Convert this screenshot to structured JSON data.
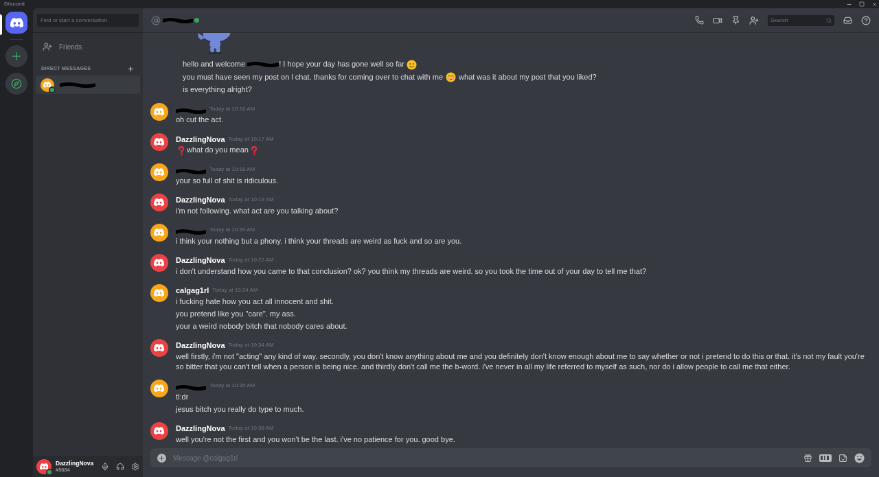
{
  "window": {
    "title": "Discord"
  },
  "search": {
    "placeholder": "Find or start a conversation"
  },
  "nav": [
    {
      "label": "Friends",
      "selected": false
    }
  ],
  "dm_section": {
    "title": "DIRECT MESSAGES"
  },
  "direct_messages": [
    {
      "selected": true,
      "online": true,
      "color": "#faa61a"
    }
  ],
  "header": {
    "online": true
  },
  "header_search": {
    "placeholder": "Search"
  },
  "messages": [
    {
      "kind": "continuation",
      "lines": [
        [
          {
            "kind": "text",
            "text": "hello and welcome "
          },
          {
            "kind": "redaction"
          },
          {
            "kind": "text",
            "text": "! I hope your day has gone well so far"
          },
          {
            "kind": "smile"
          }
        ],
        [
          {
            "kind": "text",
            "text": "you must have seen my post on l chat. thanks for coming over to chat with me"
          },
          {
            "kind": "blush"
          },
          {
            "kind": "text",
            "text": "what was it about my post that you liked?"
          }
        ],
        [
          {
            "kind": "text",
            "text": "is everything alright?"
          }
        ]
      ]
    },
    {
      "kind": "group",
      "redacted": true,
      "color": "#faa61a",
      "time": "Today at 10:16 AM",
      "lines": [
        [
          {
            "kind": "text",
            "text": "oh cut the act."
          }
        ]
      ]
    },
    {
      "kind": "group",
      "redacted": false,
      "author": "DazzlingNova",
      "color": "#ed4245",
      "time": "Today at 10:17 AM",
      "lines": [
        [
          {
            "kind": "question"
          },
          {
            "kind": "text",
            "text": "what do you mean"
          },
          {
            "kind": "question"
          }
        ]
      ]
    },
    {
      "kind": "group",
      "redacted": true,
      "color": "#faa61a",
      "time": "Today at 10:18 AM",
      "lines": [
        [
          {
            "kind": "text",
            "text": "your so full of shit is ridiculous."
          }
        ]
      ]
    },
    {
      "kind": "group",
      "redacted": false,
      "author": "DazzlingNova",
      "color": "#ed4245",
      "time": "Today at 10:19 AM",
      "lines": [
        [
          {
            "kind": "text",
            "text": "i'm not following. what act are you talking about?"
          }
        ]
      ]
    },
    {
      "kind": "group",
      "redacted": true,
      "color": "#faa61a",
      "time": "Today at 10:20 AM",
      "lines": [
        [
          {
            "kind": "text",
            "text": "i think your nothing but a phony. i think your threads are weird as fuck and so are you."
          }
        ]
      ]
    },
    {
      "kind": "group",
      "redacted": false,
      "author": "DazzlingNova",
      "color": "#ed4245",
      "time": "Today at 10:22 AM",
      "lines": [
        [
          {
            "kind": "text",
            "text": "i don't understand how you came to that conclusion? ok? you think my threads are weird. so you took the time out of your day to tell me that?"
          }
        ]
      ]
    },
    {
      "kind": "group",
      "redacted": false,
      "author": "calgag1rl",
      "color": "#faa61a",
      "time": "Today at 10:24 AM",
      "lines": [
        [
          {
            "kind": "text",
            "text": "i fucking hate how you act all innocent and shit."
          }
        ],
        [
          {
            "kind": "text",
            "text": "you pretend like you \"care\". my ass."
          }
        ],
        [
          {
            "kind": "text",
            "text": "your a weird nobody bitch that nobody cares about."
          }
        ]
      ]
    },
    {
      "kind": "group",
      "redacted": false,
      "author": "DazzlingNova",
      "color": "#ed4245",
      "time": "Today at 10:34 AM",
      "lines": [
        [
          {
            "kind": "text",
            "text": "well firstly, i'm not \"acting\" any kind of way. secondly, you don't know anything about me and you definitely don't know enough about me to say whether or not i pretend to do this or that. it's not my fault you're so bitter that you can't tell when a person is being nice. and thirdly don't call me the b-word. i've never in all my life referred to myself as such, nor do i allow people to call me that either."
          }
        ]
      ]
    },
    {
      "kind": "group",
      "redacted": true,
      "color": "#faa61a",
      "time": "Today at 10:35 AM",
      "lines": [
        [
          {
            "kind": "text",
            "text": "tl:dr"
          }
        ],
        [
          {
            "kind": "text",
            "text": "jesus bitch you really do type to much."
          }
        ]
      ]
    },
    {
      "kind": "group",
      "redacted": false,
      "author": "DazzlingNova",
      "color": "#ed4245",
      "time": "Today at 10:38 AM",
      "lines": [
        [
          {
            "kind": "text",
            "text": "well you're not the first and you won't be the last. i've no patience for you. good bye."
          }
        ]
      ]
    }
  ],
  "composer": {
    "placeholder": "Message @calgag1rl"
  },
  "user": {
    "name": "DazzlingNova",
    "tag": "#5684",
    "online": true,
    "color": "#ed4245"
  }
}
